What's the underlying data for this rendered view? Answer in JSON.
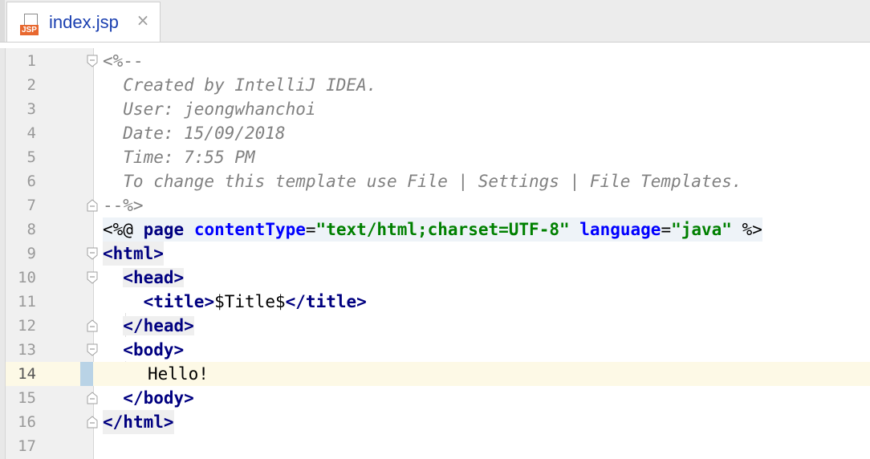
{
  "tab": {
    "icon_badge": "JSP",
    "title": "index.jsp",
    "close": "×"
  },
  "lines": [
    {
      "n": "1"
    },
    {
      "n": "2"
    },
    {
      "n": "3"
    },
    {
      "n": "4"
    },
    {
      "n": "5"
    },
    {
      "n": "6"
    },
    {
      "n": "7"
    },
    {
      "n": "8"
    },
    {
      "n": "9"
    },
    {
      "n": "10"
    },
    {
      "n": "11"
    },
    {
      "n": "12"
    },
    {
      "n": "13"
    },
    {
      "n": "14"
    },
    {
      "n": "15"
    },
    {
      "n": "16"
    },
    {
      "n": "17"
    }
  ],
  "code": {
    "l1": "<%--",
    "l2": "  Created by IntelliJ IDEA.",
    "l3": "  User: jeongwhanchoi",
    "l4": "  Date: 15/09/2018",
    "l5": "  Time: 7:55 PM",
    "l6": "  To change this template use File | Settings | File Templates.",
    "l7": "--%>",
    "l8_open": "<%@ ",
    "l8_page": "page",
    "l8_ct": "contentType",
    "l8_eq1": "=",
    "l8_ctv": "\"text/html;charset=UTF-8\"",
    "l8_lang": "language",
    "l8_eq2": "=",
    "l8_langv": "\"java\"",
    "l8_close": " %>",
    "l9_lt": "<",
    "l9_tag": "html",
    "l9_gt": ">",
    "l10_lt": "<",
    "l10_tag": "head",
    "l10_gt": ">",
    "l11_lt": "<",
    "l11_tag": "title",
    "l11_gt": ">",
    "l11_text": "$Title$",
    "l11_lt2": "</",
    "l11_tag2": "title",
    "l11_gt2": ">",
    "l12_lt": "</",
    "l12_tag": "head",
    "l12_gt": ">",
    "l13_lt": "<",
    "l13_tag": "body",
    "l13_gt": ">",
    "l14": "Hello!",
    "l15_lt": "</",
    "l15_tag": "body",
    "l15_gt": ">",
    "l16_lt": "</",
    "l16_tag": "html",
    "l16_gt": ">"
  },
  "current_line": "14",
  "colors": {
    "tag": "#000080",
    "attribute": "#0000ff",
    "string": "#008000",
    "comment": "#808080",
    "current_line_bg": "#fdf9e6",
    "jsp_badge": "#e8682f"
  }
}
